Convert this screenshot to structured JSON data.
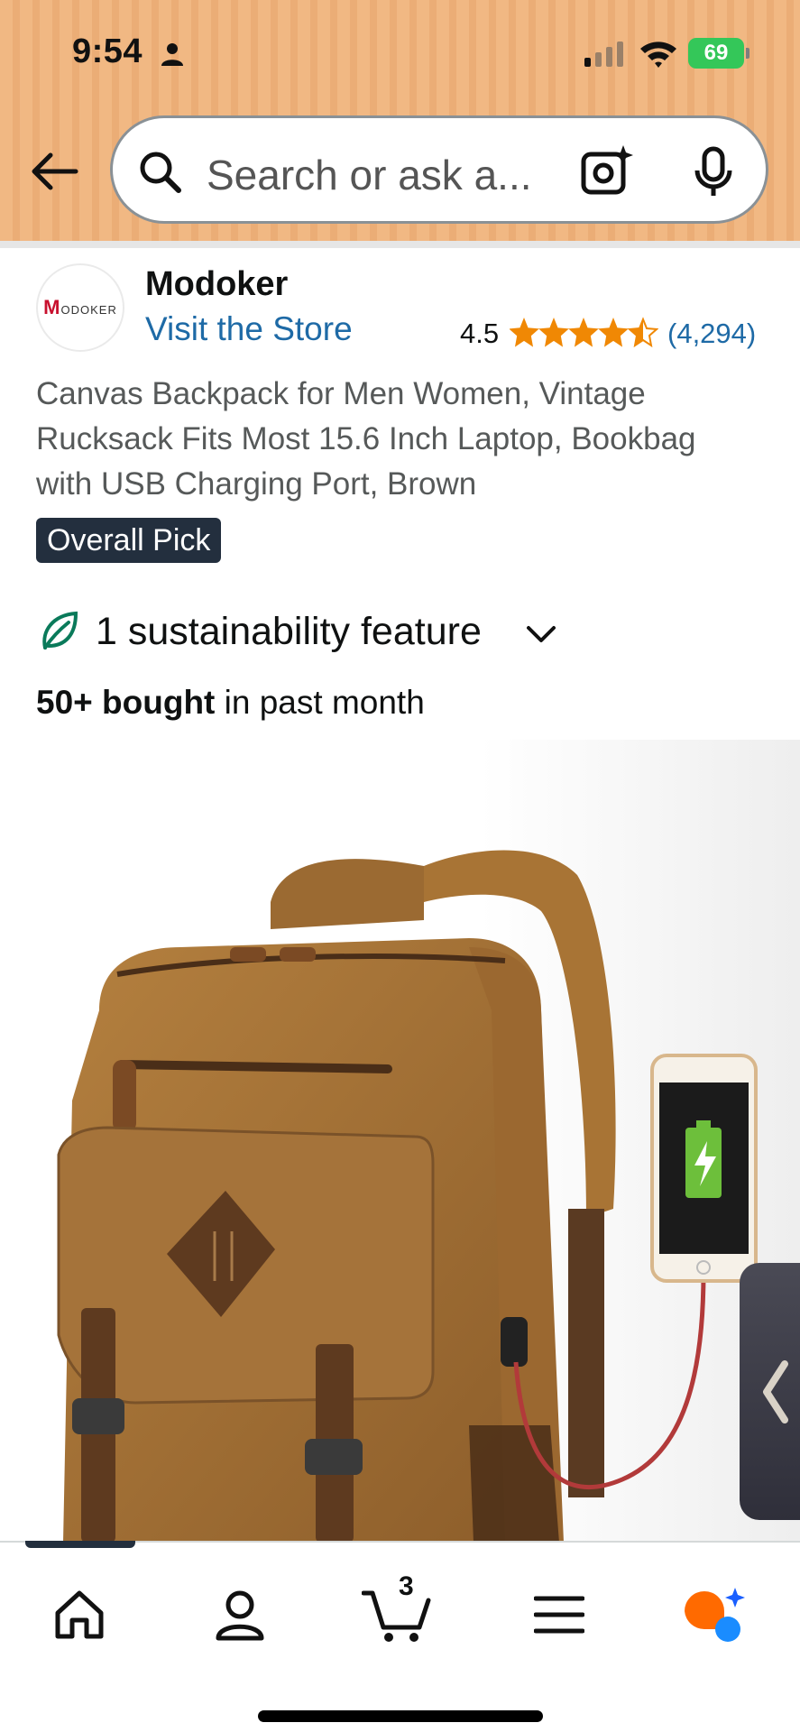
{
  "status_bar": {
    "time": "9:54",
    "battery": "69"
  },
  "search": {
    "placeholder": "Search or ask a..."
  },
  "brand": {
    "logo_text": "ODOKER",
    "logo_initial": "M",
    "name": "Modoker",
    "visit_store": "Visit the Store"
  },
  "rating": {
    "value": "4.5",
    "stars": 4.5,
    "count": "(4,294)"
  },
  "product": {
    "title": "Canvas Backpack for Men Women, Vintage Rucksack Fits Most 15.6 Inch Laptop, Bookbag with USB Charging Port, Brown",
    "badge": "Overall Pick",
    "sustainability": "1 sustainability feature",
    "bought_bold": "50+ bought",
    "bought_rest": " in past month"
  },
  "bottom_nav": {
    "cart_count": "3"
  },
  "colors": {
    "header": "#f1b883",
    "link": "#1e6aa6",
    "star": "#f08804",
    "badge_bg": "#232f3e"
  }
}
